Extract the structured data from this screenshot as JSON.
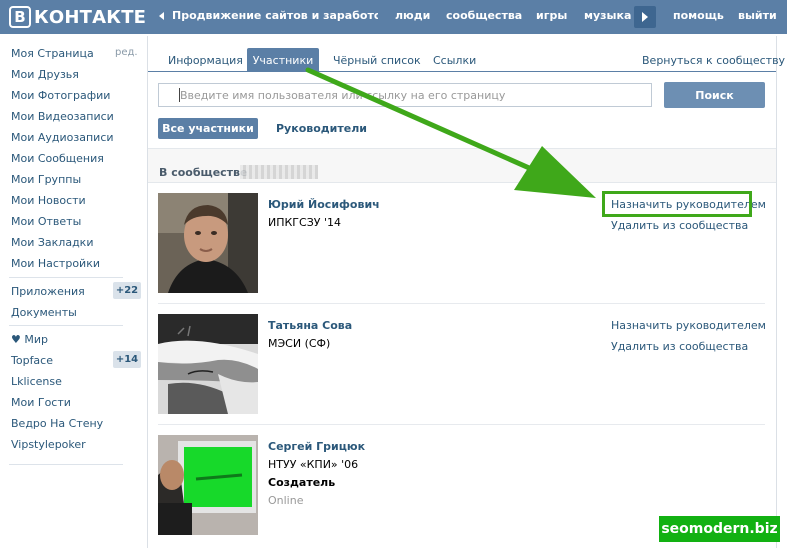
{
  "header": {
    "logo_letter": "В",
    "logo_text": "КОНТАКТЕ",
    "ticker": "Продвижение сайтов и заработо...",
    "nav": [
      "люди",
      "сообщества",
      "игры",
      "музыка",
      "помощь",
      "выйти"
    ]
  },
  "sidebar": {
    "edit": "ред.",
    "items": [
      "Моя Страница",
      "Мои Друзья",
      "Мои Фотографии",
      "Мои Видеозаписи",
      "Мои Аудиозаписи",
      "Мои Сообщения",
      "Мои Группы",
      "Мои Новости",
      "Мои Ответы",
      "Мои Закладки",
      "Мои Настройки"
    ],
    "apps": [
      {
        "label": "Приложения",
        "badge": "+22"
      },
      {
        "label": "Документы",
        "badge": ""
      }
    ],
    "games": [
      {
        "label": "♥ Мир",
        "badge": ""
      },
      {
        "label": "Topface",
        "badge": "+14"
      },
      {
        "label": "Lklicense",
        "badge": ""
      },
      {
        "label": "Мои Гости",
        "badge": ""
      },
      {
        "label": "Ведро На Стену",
        "badge": ""
      },
      {
        "label": "Vipstylepoker",
        "badge": ""
      }
    ]
  },
  "tabs": {
    "info": "Информация",
    "members": "Участники",
    "blacklist": "Чёрный список",
    "links": "Ссылки",
    "back": "Вернуться к сообществу"
  },
  "search": {
    "placeholder": "Введите имя пользователя или ссылку на его страницу",
    "button": "Поиск"
  },
  "filters": {
    "all": "Все участники",
    "managers": "Руководители"
  },
  "section_title": "В сообществе",
  "members": [
    {
      "name": "Юрий Йосифович",
      "info": "ИПКГСЗУ '14",
      "role": "",
      "status": "",
      "action1": "Назначить руководителем",
      "action2": "Удалить из сообщества"
    },
    {
      "name": "Татьяна Сова",
      "info": "МЭСИ (СФ)",
      "role": "",
      "status": "",
      "action1": "Назначить руководителем",
      "action2": "Удалить из сообщества"
    },
    {
      "name": "Сергей Грицюк",
      "info": "НТУУ «КПИ» '06",
      "role": "Создатель",
      "status": "Online",
      "action1": "",
      "action2": ""
    }
  ],
  "watermark": "seomodern.biz",
  "colors": {
    "header": "#5b7fa6",
    "link": "#2b587a",
    "highlight": "#3fa81a"
  }
}
